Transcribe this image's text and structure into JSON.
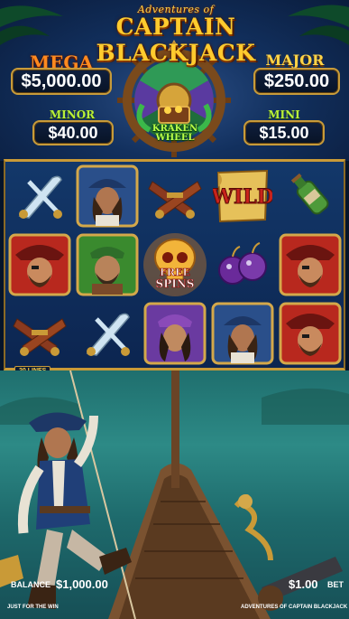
{
  "header": {
    "logo_top": "Adventures of",
    "logo_main": "CAPTAIN BLACKJACK"
  },
  "jackpots": {
    "mega": {
      "label": "MEGA",
      "value": "$5,000.00"
    },
    "major": {
      "label": "MAJOR",
      "value": "$250.00"
    },
    "minor": {
      "label": "MINOR",
      "value": "$40.00"
    },
    "mini": {
      "label": "MINI",
      "value": "$15.00"
    }
  },
  "kraken_wheel": {
    "line1": "KRAKEN",
    "line2": "WHEEL"
  },
  "reels": {
    "symbols": [
      [
        "swords",
        "pirate-woman",
        "pistols",
        "wild",
        "rum-bottle"
      ],
      [
        "captain",
        "green-pirate",
        "free-spins",
        "bombs",
        "captain"
      ],
      [
        "pistols",
        "swords",
        "purple-woman",
        "pirate-woman",
        "captain"
      ]
    ],
    "wild_text": "WILD",
    "free_spins_line1": "FREE",
    "free_spins_line2": "SPINS",
    "lines_label": "20 LINES"
  },
  "status_bar": {
    "balance_label": "BALANCE",
    "balance_value": "$1,000.00",
    "bet_value": "$1.00",
    "bet_label": "BET",
    "brand_left": "JUST FOR THE WIN",
    "brand_right": "ADVENTURES OF CAPTAIN BLACKJACK"
  },
  "colors": {
    "gold": "#c99a37",
    "reel_bg": "#13386a",
    "sea": "#2d8a86",
    "mega_orange": "#ff8a1f",
    "mini_green": "#b9f03a"
  }
}
